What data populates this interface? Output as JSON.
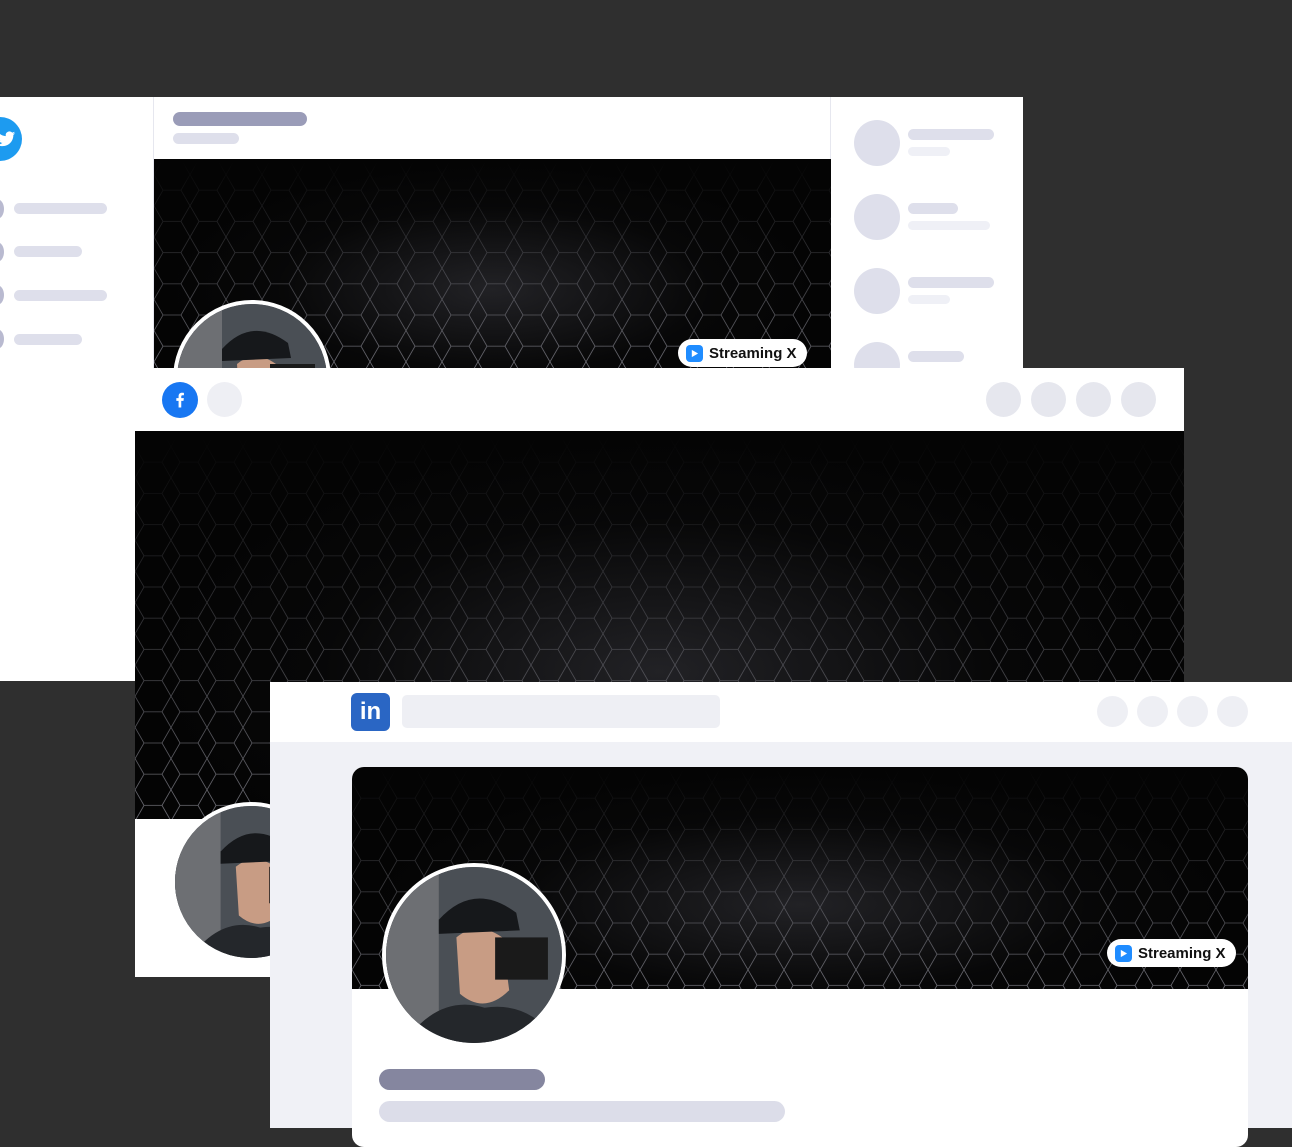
{
  "twitter": {
    "logo_icon": "twitter-bird-icon",
    "banner_badge": {
      "icon": "play-icon",
      "label": "Streaming X"
    }
  },
  "facebook": {
    "logo_icon": "facebook-f-icon"
  },
  "linkedin": {
    "logo_icon": "linkedin-in-icon",
    "logo_text": "in",
    "banner_badge": {
      "icon": "play-icon",
      "label": "Streaming X"
    }
  },
  "colors": {
    "background": "#2f2f2f",
    "twitter_blue": "#1d9bf0",
    "facebook_blue": "#1877f2",
    "linkedin_blue": "#2a66c4",
    "badge_play": "#1f8cff",
    "placeholder_dark": "#9a9cb8",
    "placeholder_light": "#e3e4ee"
  }
}
